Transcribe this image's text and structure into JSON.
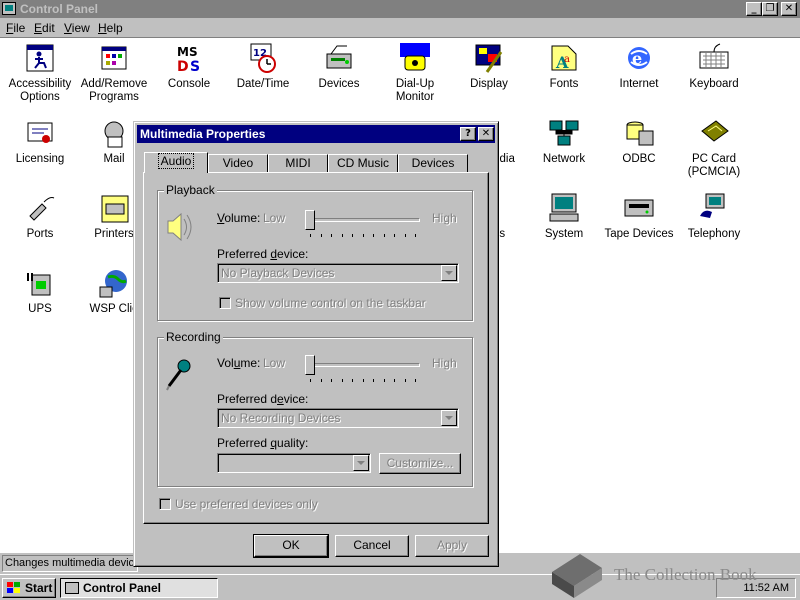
{
  "window": {
    "title": "Control Panel",
    "minimize_glyph": "_",
    "restore_glyph": "❐",
    "close_glyph": "✕"
  },
  "menu": [
    {
      "label": "File",
      "key": "F",
      "rest": "ile"
    },
    {
      "label": "Edit",
      "key": "E",
      "rest": "dit"
    },
    {
      "label": "View",
      "key": "V",
      "rest": "iew"
    },
    {
      "label": "Help",
      "key": "H",
      "rest": "elp"
    }
  ],
  "items": [
    {
      "line1": "Accessibility",
      "line2": "Options",
      "icon": "accessibility-icon"
    },
    {
      "line1": "Add/Remove",
      "line2": "Programs",
      "icon": "add-remove-programs-icon"
    },
    {
      "line1": "Console",
      "line2": "",
      "icon": "console-icon"
    },
    {
      "line1": "Date/Time",
      "line2": "",
      "icon": "date-time-icon"
    },
    {
      "line1": "Devices",
      "line2": "",
      "icon": "devices-icon"
    },
    {
      "line1": "Dial-Up",
      "line2": "Monitor",
      "icon": "dialup-monitor-icon"
    },
    {
      "line1": "Display",
      "line2": "",
      "icon": "display-icon"
    },
    {
      "line1": "Fonts",
      "line2": "",
      "icon": "fonts-icon"
    },
    {
      "line1": "Internet",
      "line2": "",
      "icon": "internet-icon"
    },
    {
      "line1": "Keyboard",
      "line2": "",
      "icon": "keyboard-icon"
    },
    {
      "line1": "Licensing",
      "line2": "",
      "icon": "licensing-icon"
    },
    {
      "line1": "Mail",
      "line2": "",
      "icon": "mail-icon"
    },
    {
      "line1": "edia",
      "line2": "",
      "icon": "partial-icon"
    },
    {
      "line1": "Network",
      "line2": "",
      "icon": "network-icon"
    },
    {
      "line1": "ODBC",
      "line2": "",
      "icon": "odbc-icon"
    },
    {
      "line1": "PC Card",
      "line2": "(PCMCIA)",
      "icon": "pc-card-icon"
    },
    {
      "line1": "Ports",
      "line2": "",
      "icon": "ports-icon"
    },
    {
      "line1": "Printers",
      "line2": "",
      "icon": "printers-icon"
    },
    {
      "line1": "ds",
      "line2": "",
      "icon": "partial-icon"
    },
    {
      "line1": "System",
      "line2": "",
      "icon": "system-icon"
    },
    {
      "line1": "Tape Devices",
      "line2": "",
      "icon": "tape-devices-icon"
    },
    {
      "line1": "Telephony",
      "line2": "",
      "icon": "telephony-icon"
    },
    {
      "line1": "UPS",
      "line2": "",
      "icon": "ups-icon"
    },
    {
      "line1": "WSP Clie",
      "line2": "",
      "icon": "wsp-client-icon"
    }
  ],
  "status_text": "Changes multimedia device",
  "dialog": {
    "title": "Multimedia Properties",
    "help_glyph": "?",
    "close_glyph": "✕",
    "tabs": [
      "Audio",
      "Video",
      "MIDI",
      "CD Music",
      "Devices"
    ],
    "active_tab": "Audio",
    "playback": {
      "legend": "Playback",
      "volume_label": "Volume:",
      "volume_key": "V",
      "volume_rest": "olume:",
      "low": "Low",
      "high": "High",
      "volume_level": 0,
      "device_label_pre": "Preferred ",
      "device_label_key": "d",
      "device_label_post": "evice:",
      "device_value": "No Playback Devices",
      "show_control_label": "Show volume control on the taskbar",
      "show_control_checked": false
    },
    "recording": {
      "legend": "Recording",
      "volume_pre": "Vol",
      "volume_key": "u",
      "volume_post": "me:",
      "low": "Low",
      "high": "High",
      "volume_level": 0,
      "device_pre": "Preferred d",
      "device_key": "e",
      "device_post": "vice:",
      "device_value": "No Recording Devices",
      "quality_pre": "Preferred ",
      "quality_key": "q",
      "quality_post": "uality:",
      "quality_value": "",
      "customize_label": "Customize..."
    },
    "preferred_only_label": "Use preferred devices only",
    "preferred_only_checked": false,
    "ok": "OK",
    "cancel": "Cancel",
    "apply": "Apply"
  },
  "taskbar": {
    "start": "Start",
    "task": "Control Panel",
    "clock": "11:52 AM"
  },
  "watermark": "The Collection Book"
}
